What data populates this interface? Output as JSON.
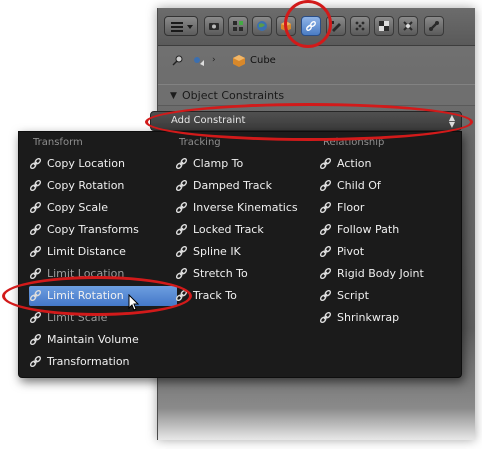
{
  "header": {
    "tabs": [
      {
        "icon": "camera-icon"
      },
      {
        "icon": "layers-icon"
      },
      {
        "icon": "world-icon"
      },
      {
        "icon": "object-icon"
      },
      {
        "icon": "constraint-icon",
        "active": true
      },
      {
        "icon": "modifier-icon"
      },
      {
        "icon": "particles-icon"
      },
      {
        "icon": "physics-icon"
      },
      {
        "icon": "data-icon"
      }
    ]
  },
  "breadcrumb": {
    "object_name": "Cube"
  },
  "section": {
    "title": "Object Constraints"
  },
  "add_constraint": {
    "label": "Add Constraint"
  },
  "menu": {
    "columns": [
      {
        "title": "Transform",
        "items": [
          {
            "label": "Copy Location"
          },
          {
            "label": "Copy Rotation"
          },
          {
            "label": "Copy Scale"
          },
          {
            "label": "Copy Transforms"
          },
          {
            "label": "Limit Distance"
          },
          {
            "label": "Limit Location",
            "dim": true
          },
          {
            "label": "Limit Rotation",
            "highlighted": true
          },
          {
            "label": "Limit Scale",
            "dim": true
          },
          {
            "label": "Maintain Volume"
          },
          {
            "label": "Transformation"
          }
        ]
      },
      {
        "title": "Tracking",
        "items": [
          {
            "label": "Clamp To"
          },
          {
            "label": "Damped Track"
          },
          {
            "label": "Inverse Kinematics"
          },
          {
            "label": "Locked Track"
          },
          {
            "label": "Spline IK"
          },
          {
            "label": "Stretch To"
          },
          {
            "label": "Track To"
          }
        ]
      },
      {
        "title": "Relationship",
        "items": [
          {
            "label": "Action"
          },
          {
            "label": "Child Of"
          },
          {
            "label": "Floor"
          },
          {
            "label": "Follow Path"
          },
          {
            "label": "Pivot"
          },
          {
            "label": "Rigid Body Joint"
          },
          {
            "label": "Script"
          },
          {
            "label": "Shrinkwrap"
          }
        ]
      }
    ]
  },
  "colors": {
    "menu_bg": "#1b1b1b",
    "highlight": "#5a8ad4",
    "annotation_red": "#d21a1a",
    "active_tab": "#5b8fd8"
  }
}
